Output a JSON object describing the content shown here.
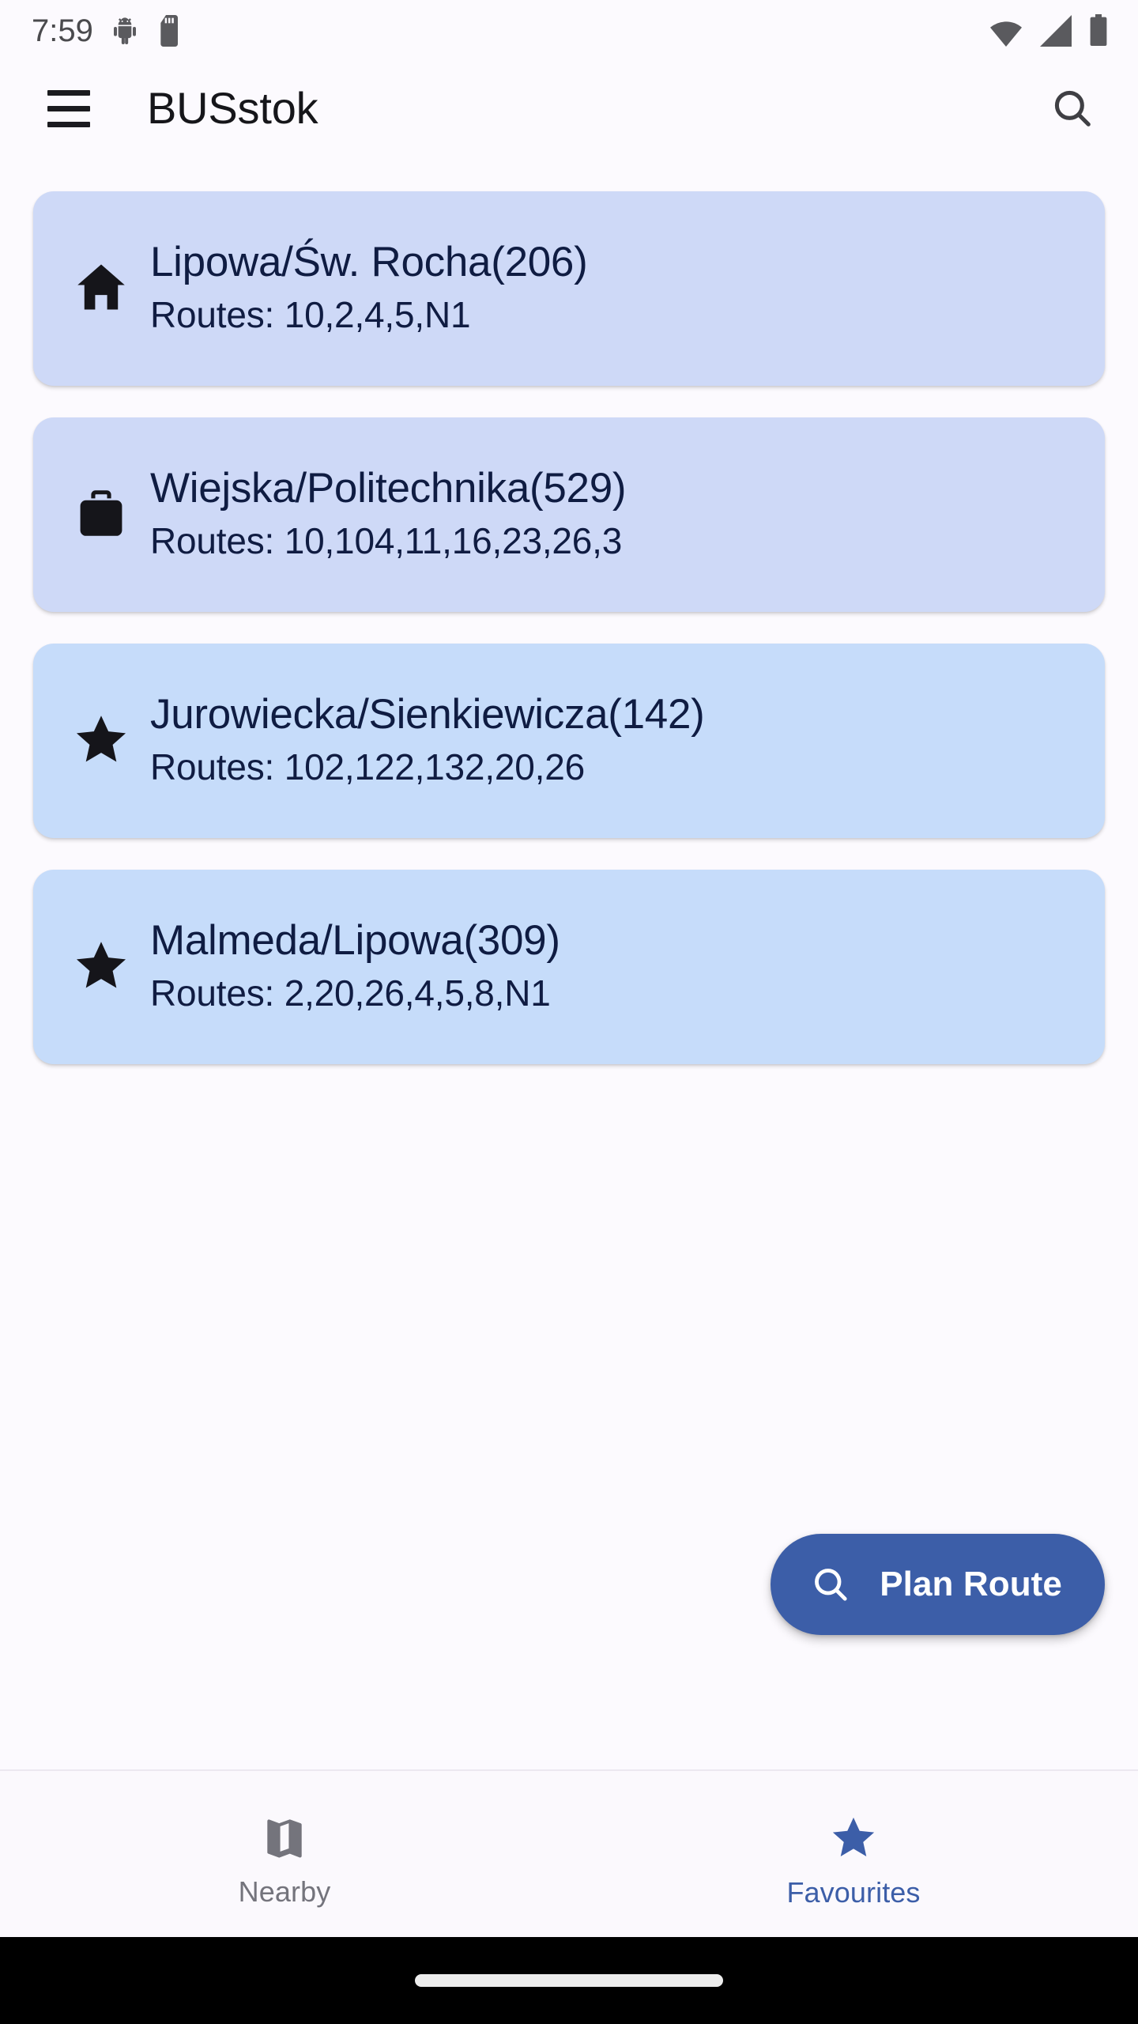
{
  "status_bar": {
    "time": "7:59",
    "left_icons": [
      "android-debug-icon",
      "sd-card-icon"
    ],
    "right_icons": [
      "wifi-icon",
      "cellular-signal-icon",
      "battery-icon"
    ]
  },
  "app_bar": {
    "menu_icon": "hamburger-menu-icon",
    "title": "BUSstok",
    "search_icon": "search-icon"
  },
  "stops": [
    {
      "icon": "home-icon",
      "name": "Lipowa/Św. Rocha(206)",
      "routes": "Routes: 10,2,4,5,N1",
      "bg": "#CED9F7"
    },
    {
      "icon": "briefcase-icon",
      "name": "Wiejska/Politechnika(529)",
      "routes": "Routes: 10,104,11,16,23,26,3",
      "bg": "#CED9F7"
    },
    {
      "icon": "star-icon",
      "name": "Jurowiecka/Sienkiewicza(142)",
      "routes": "Routes: 102,122,132,20,26",
      "bg": "#C6DCFA"
    },
    {
      "icon": "star-icon",
      "name": "Malmeda/Lipowa(309)",
      "routes": "Routes: 2,20,26,4,5,8,N1",
      "bg": "#C6DCFA"
    }
  ],
  "fab": {
    "label": "Plan Route",
    "icon": "search-icon",
    "color": "#3C5EA8",
    "text_color": "#FFFFFF"
  },
  "bottom_nav": {
    "items": [
      {
        "label": "Nearby",
        "icon": "map-icon",
        "active": false,
        "color": "#74747C"
      },
      {
        "label": "Favourites",
        "icon": "star-icon",
        "active": true,
        "color": "#3C5EA8"
      }
    ]
  },
  "colors": {
    "page_background": "#FCFAFE",
    "card_text": "#101C42",
    "accent": "#3C5EA8",
    "gesture_bar": "#000000"
  }
}
